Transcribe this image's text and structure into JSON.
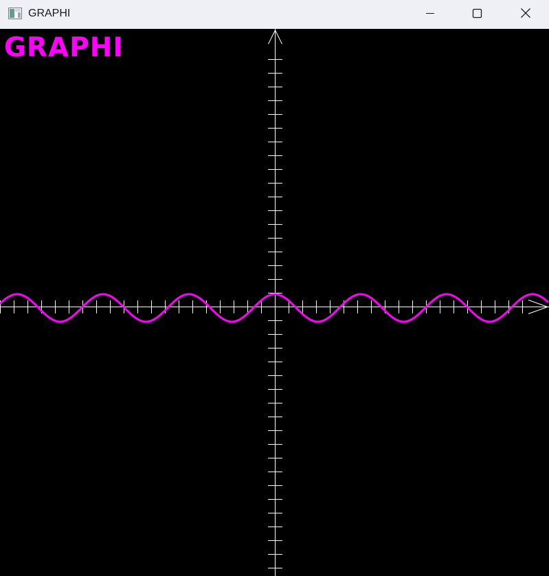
{
  "window": {
    "title": "GRAPHI"
  },
  "canvas": {
    "brand_text": "GRAPHI",
    "background": "#000000",
    "axis_color": "#ffffff",
    "curve_color": "#ff00ff"
  },
  "icons": {
    "app": "app-window-icon",
    "minimize": "minimize-icon",
    "maximize": "maximize-icon",
    "close": "close-icon"
  }
}
